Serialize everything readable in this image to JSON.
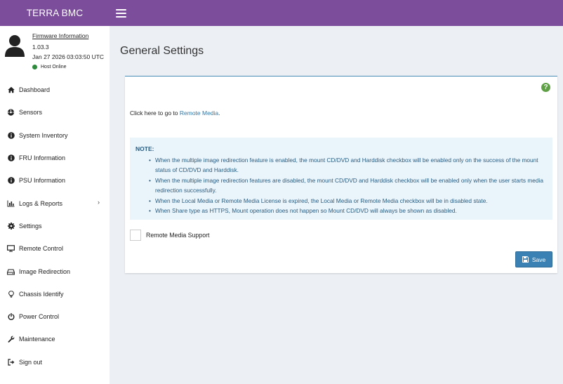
{
  "header": {
    "brand": "TERRA BMC",
    "menu_icon": "hamburger-menu-icon"
  },
  "user_panel": {
    "avatar_icon": "user-avatar-icon",
    "firmware_link": "Firmware Information",
    "firmware_version": "1.03.3",
    "datetime": "Jan 27 2026 03:03:50 UTC",
    "host_status": "Host Online",
    "host_status_color": "#2e8b3e"
  },
  "sidebar": {
    "items": [
      {
        "label": "Dashboard",
        "icon": "home-icon"
      },
      {
        "label": "Sensors",
        "icon": "sensors-icon"
      },
      {
        "label": "System Inventory",
        "icon": "info-circle-icon"
      },
      {
        "label": "FRU Information",
        "icon": "info-circle-icon"
      },
      {
        "label": "PSU Information",
        "icon": "info-circle-icon"
      },
      {
        "label": "Logs & Reports",
        "icon": "bar-chart-icon",
        "expandable": true
      },
      {
        "label": "Settings",
        "icon": "gear-icon"
      },
      {
        "label": "Remote Control",
        "icon": "monitor-icon"
      },
      {
        "label": "Image Redirection",
        "icon": "hard-drive-icon"
      },
      {
        "label": "Chassis Identify",
        "icon": "lightbulb-icon"
      },
      {
        "label": "Power Control",
        "icon": "power-icon"
      },
      {
        "label": "Maintenance",
        "icon": "wrench-icon"
      },
      {
        "label": "Sign out",
        "icon": "sign-out-icon"
      }
    ]
  },
  "main": {
    "title": "General Settings",
    "help_icon": "help-icon",
    "click_here_prefix": "Click here to go to ",
    "click_here_link": "Remote Media",
    "click_here_suffix": ".",
    "note_title": "NOTE:",
    "notes": [
      "When the multiple image redirection feature is enabled, the mount CD/DVD and Harddisk checkbox will be enabled only on the success of the mount status of CD/DVD and Harddisk.",
      "When the multiple image redirection features are disabled, the mount CD/DVD and Harddisk checkbox will be enabled only when the user starts media redirection successfully.",
      "When the Local Media or Remote Media License is expired, the Local Media or Remote Media checkbox will be in disabled state.",
      "When Share type as HTTPS, Mount operation does not happen so Mount CD/DVD will always be shown as disabled."
    ],
    "remote_media_support_label": "Remote Media Support",
    "remote_media_support_checked": false,
    "save_label": "Save",
    "save_icon": "floppy-disk-icon"
  },
  "colors": {
    "header_bg": "#7b4d9b",
    "accent_blue": "#3c81b4",
    "note_bg": "#eaf4fb",
    "note_text": "#2a5d80"
  }
}
